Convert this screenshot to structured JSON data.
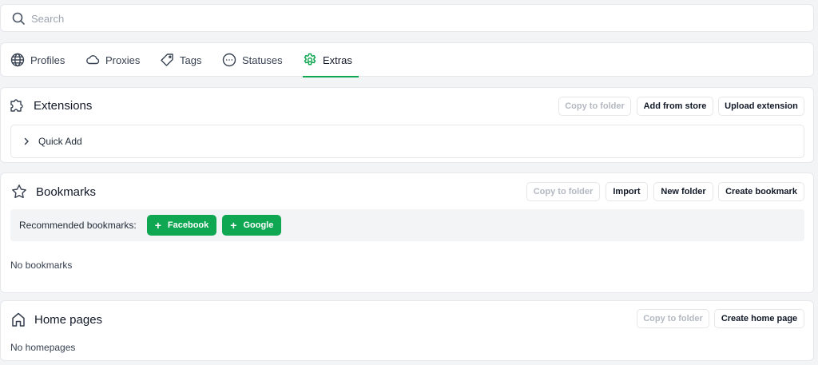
{
  "search": {
    "placeholder": "Search"
  },
  "tabs": [
    {
      "label": "Profiles",
      "icon": "globe-icon"
    },
    {
      "label": "Proxies",
      "icon": "cloud-icon"
    },
    {
      "label": "Tags",
      "icon": "tag-icon"
    },
    {
      "label": "Statuses",
      "icon": "dots-circle-icon"
    },
    {
      "label": "Extras",
      "icon": "gear-icon",
      "active": true
    }
  ],
  "extensions": {
    "title": "Extensions",
    "copy_label": "Copy to folder",
    "add_store_label": "Add from store",
    "upload_label": "Upload extension",
    "quick_add_label": "Quick Add"
  },
  "bookmarks": {
    "title": "Bookmarks",
    "copy_label": "Copy to folder",
    "import_label": "Import",
    "new_folder_label": "New folder",
    "create_label": "Create bookmark",
    "recommended_label": "Recommended bookmarks:",
    "recommended": [
      {
        "label": "Facebook"
      },
      {
        "label": "Google"
      }
    ],
    "empty_text": "No bookmarks"
  },
  "home_pages": {
    "title": "Home pages",
    "copy_label": "Copy to folder",
    "create_label": "Create home page",
    "empty_text": "No homepages"
  },
  "colors": {
    "accent": "#10a752",
    "background": "#f3f4f6",
    "card": "#ffffff",
    "disabled_text": "#b3b8c1"
  }
}
